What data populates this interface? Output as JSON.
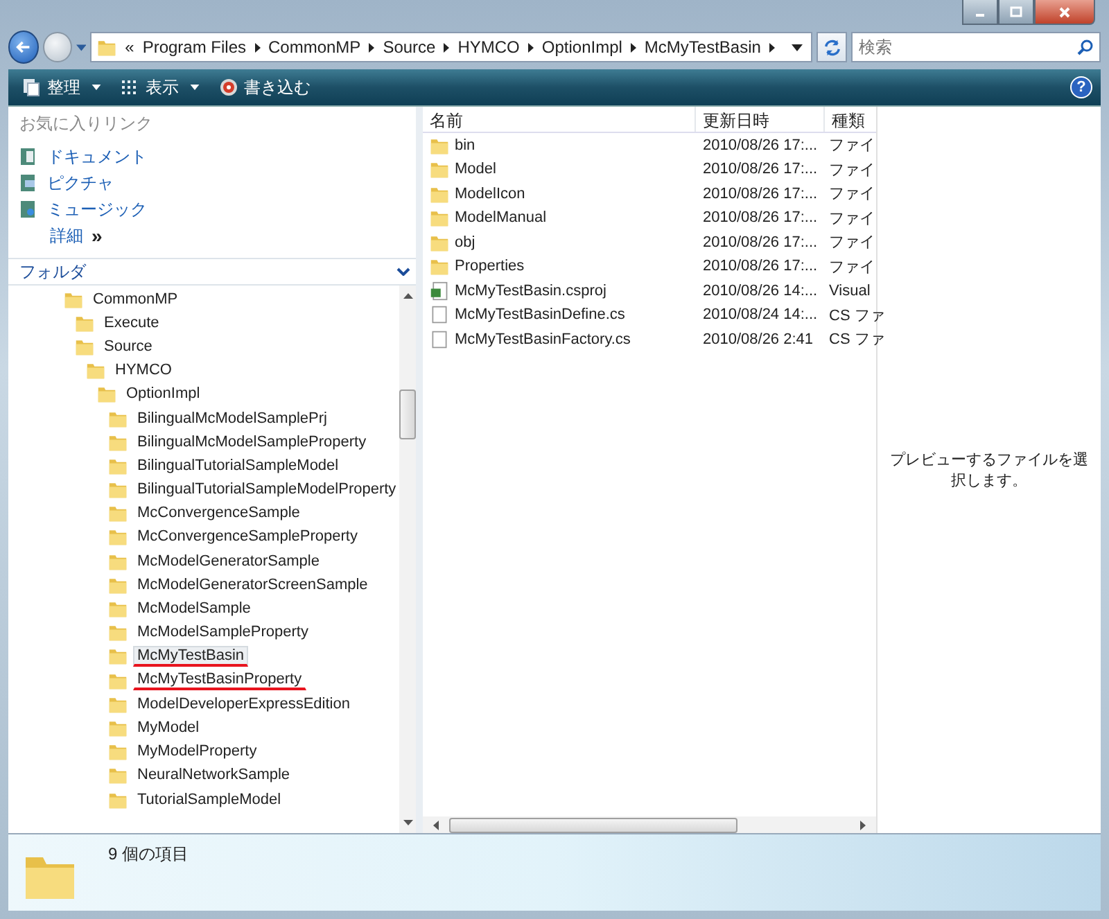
{
  "address": {
    "overflow": "«",
    "crumbs": [
      "Program Files",
      "CommonMP",
      "Source",
      "HYMCO",
      "OptionImpl",
      "McMyTestBasin"
    ]
  },
  "search": {
    "placeholder": "検索"
  },
  "toolbar": {
    "items": [
      {
        "label": "整理",
        "kind": "organize",
        "dropdown": true
      },
      {
        "label": "表示",
        "kind": "views",
        "dropdown": true
      },
      {
        "label": "書き込む",
        "kind": "burn",
        "dropdown": false
      }
    ],
    "help": "?"
  },
  "favorites": {
    "title": "お気に入りリンク",
    "links": [
      {
        "label": "ドキュメント",
        "kind": "documents"
      },
      {
        "label": "ピクチャ",
        "kind": "pictures"
      },
      {
        "label": "ミュージック",
        "kind": "music"
      }
    ],
    "more": "詳細",
    "more_arrows": "»"
  },
  "folders": {
    "title": "フォルダ",
    "tree": [
      {
        "label": "CommonMP",
        "selected": false,
        "underlined": false,
        "children": [
          {
            "label": "Execute",
            "selected": false,
            "underlined": false
          },
          {
            "label": "Source",
            "selected": false,
            "underlined": false,
            "children": [
              {
                "label": "HYMCO",
                "selected": false,
                "underlined": false,
                "children": [
                  {
                    "label": "OptionImpl",
                    "selected": false,
                    "underlined": false,
                    "children": [
                      {
                        "label": "BilingualMcModelSamplePrj",
                        "selected": false,
                        "underlined": false
                      },
                      {
                        "label": "BilingualMcModelSampleProperty",
                        "selected": false,
                        "underlined": false
                      },
                      {
                        "label": "BilingualTutorialSampleModel",
                        "selected": false,
                        "underlined": false
                      },
                      {
                        "label": "BilingualTutorialSampleModelProperty",
                        "selected": false,
                        "underlined": false
                      },
                      {
                        "label": "McConvergenceSample",
                        "selected": false,
                        "underlined": false
                      },
                      {
                        "label": "McConvergenceSampleProperty",
                        "selected": false,
                        "underlined": false
                      },
                      {
                        "label": "McModelGeneratorSample",
                        "selected": false,
                        "underlined": false
                      },
                      {
                        "label": "McModelGeneratorScreenSample",
                        "selected": false,
                        "underlined": false
                      },
                      {
                        "label": "McModelSample",
                        "selected": false,
                        "underlined": false
                      },
                      {
                        "label": "McModelSampleProperty",
                        "selected": false,
                        "underlined": false
                      },
                      {
                        "label": "McMyTestBasin",
                        "selected": true,
                        "underlined": true
                      },
                      {
                        "label": "McMyTestBasinProperty",
                        "selected": false,
                        "underlined": true
                      },
                      {
                        "label": "ModelDeveloperExpressEdition",
                        "selected": false,
                        "underlined": false
                      },
                      {
                        "label": "MyModel",
                        "selected": false,
                        "underlined": false
                      },
                      {
                        "label": "MyModelProperty",
                        "selected": false,
                        "underlined": false
                      },
                      {
                        "label": "NeuralNetworkSample",
                        "selected": false,
                        "underlined": false
                      },
                      {
                        "label": "TutorialSampleModel",
                        "selected": false,
                        "underlined": false
                      }
                    ]
                  }
                ]
              }
            ]
          }
        ]
      }
    ]
  },
  "files": {
    "columns": [
      "名前",
      "更新日時",
      "種類"
    ],
    "rows": [
      {
        "name": "bin",
        "date": "2010/08/26 17:...",
        "type": "ファイ",
        "kind": "folder"
      },
      {
        "name": "Model",
        "date": "2010/08/26 17:...",
        "type": "ファイ",
        "kind": "folder"
      },
      {
        "name": "ModelIcon",
        "date": "2010/08/26 17:...",
        "type": "ファイ",
        "kind": "folder"
      },
      {
        "name": "ModelManual",
        "date": "2010/08/26 17:...",
        "type": "ファイ",
        "kind": "folder"
      },
      {
        "name": "obj",
        "date": "2010/08/26 17:...",
        "type": "ファイ",
        "kind": "folder"
      },
      {
        "name": "Properties",
        "date": "2010/08/26 17:...",
        "type": "ファイ",
        "kind": "folder"
      },
      {
        "name": "McMyTestBasin.csproj",
        "date": "2010/08/26 14:...",
        "type": "Visual",
        "kind": "project"
      },
      {
        "name": "McMyTestBasinDefine.cs",
        "date": "2010/08/24 14:...",
        "type": "CS ファ",
        "kind": "document"
      },
      {
        "name": "McMyTestBasinFactory.cs",
        "date": "2010/08/26 2:41",
        "type": "CS ファ",
        "kind": "document"
      }
    ]
  },
  "preview": {
    "message": "プレビューするファイルを選択します。"
  },
  "status_bar": {
    "count": "9 個の項目"
  }
}
